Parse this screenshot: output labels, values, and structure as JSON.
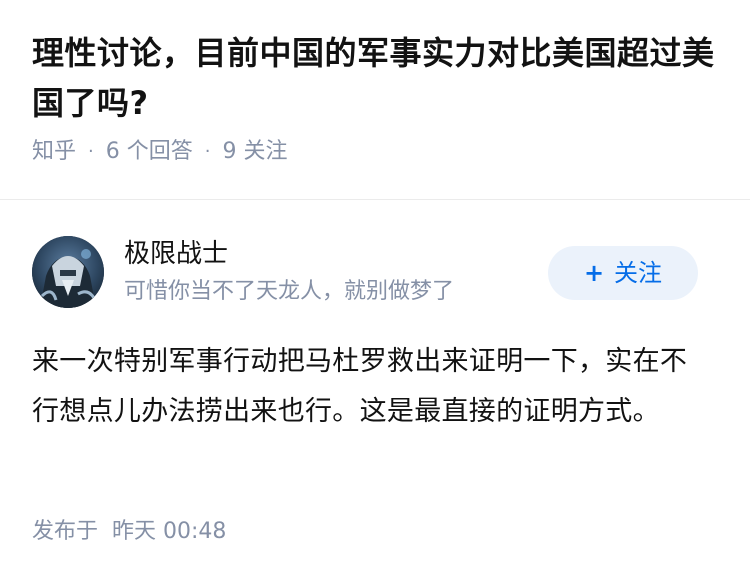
{
  "question": {
    "title": "理性讨论，目前中国的军事实力对比美国超过美国了吗?",
    "source": "知乎",
    "answer_count": "6 个回答",
    "follower_count": "9 关注"
  },
  "author": {
    "name": "极限战士",
    "bio": "可惜你当不了天龙人，就别做梦了",
    "follow_label": "关注",
    "follow_icon": "plus-icon"
  },
  "answer": {
    "content": "来一次特别军事行动把马杜罗救出来证明一下，实在不行想点儿办法捞出来也行。这是最直接的证明方式。",
    "published_label": "发布于",
    "published_time": "昨天 00:48"
  },
  "colors": {
    "accent": "#056de8",
    "muted": "#8590a6",
    "follow_bg": "#ebf2fb",
    "text": "#121212"
  }
}
